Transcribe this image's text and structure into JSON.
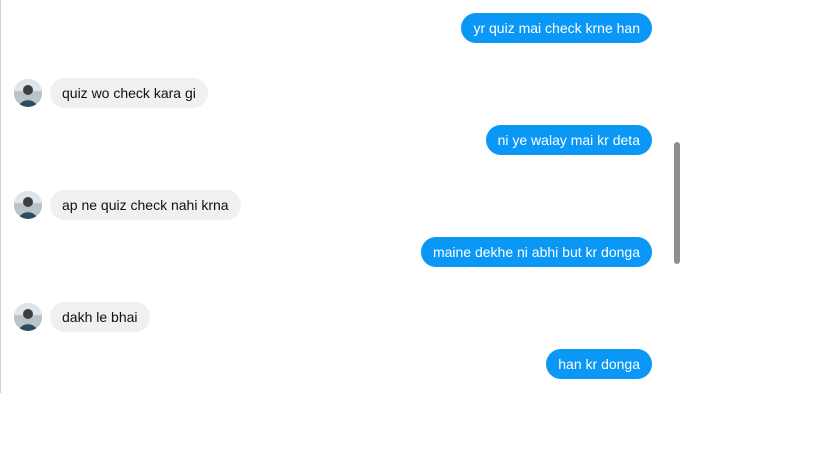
{
  "conversation": {
    "messages": [
      {
        "direction": "out",
        "text": "yr quiz mai check krne han"
      },
      {
        "direction": "in",
        "text": "quiz wo check kara gi",
        "avatar": "user-avatar"
      },
      {
        "direction": "out",
        "text": "ni ye walay mai kr deta"
      },
      {
        "direction": "in",
        "text": "ap ne quiz check nahi krna",
        "avatar": "user-avatar"
      },
      {
        "direction": "out",
        "text": "maine dekhe ni abhi but kr donga"
      },
      {
        "direction": "in",
        "text": "dakh le bhai",
        "avatar": "user-avatar"
      },
      {
        "direction": "out",
        "text": "han kr donga"
      }
    ]
  },
  "colors": {
    "outgoing_bubble": "#0a97f5",
    "incoming_bubble": "#f0f0f0",
    "scrollbar_thumb": "#8f8f8f"
  }
}
